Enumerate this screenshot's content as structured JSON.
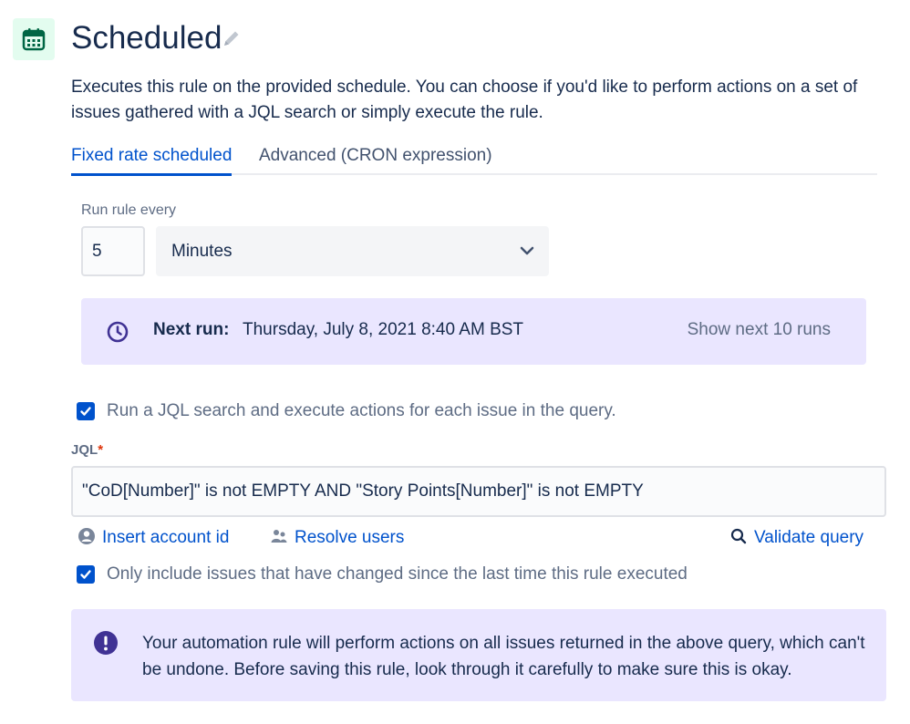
{
  "header": {
    "icon": "calendar-icon",
    "title": "Scheduled",
    "edit_icon": "pencil-icon",
    "accent_color": "#006644",
    "icon_bg": "#e3fcef"
  },
  "description": "Executes this rule on the provided schedule. You can choose if you'd like to perform actions on a set of issues gathered with a JQL search or simply execute the rule.",
  "tabs": [
    {
      "label": "Fixed rate scheduled",
      "active": true
    },
    {
      "label": "Advanced (CRON expression)",
      "active": false
    }
  ],
  "schedule": {
    "label": "Run rule every",
    "interval_value": "5",
    "unit_selected": "Minutes"
  },
  "next_run": {
    "icon": "clock-icon",
    "label": "Next run:",
    "value": "Thursday, July 8, 2021 8:40 AM BST",
    "show_next_label": "Show next 10 runs"
  },
  "jql_checkbox": {
    "checked": true,
    "label": "Run a JQL search and execute actions for each issue in the query."
  },
  "jql": {
    "label": "JQL",
    "required_marker": "*",
    "value": "\"CoD[Number]\" is not EMPTY AND \"Story Points[Number]\" is not EMPTY"
  },
  "jql_actions": {
    "insert_account_id": "Insert account id",
    "resolve_users": "Resolve users",
    "validate_query": "Validate query"
  },
  "changed_checkbox": {
    "checked": true,
    "label": "Only include issues that have changed since the last time this rule executed"
  },
  "warning": {
    "icon": "exclamation-icon",
    "text": "Your automation rule will perform actions on all issues returned in the above query, which can't be undone. Before saving this rule, look through it carefully to make sure this is okay."
  },
  "colors": {
    "primary": "#0052cc",
    "info_bg": "#eae6ff",
    "discovery": "#403294",
    "required": "#de350b"
  }
}
